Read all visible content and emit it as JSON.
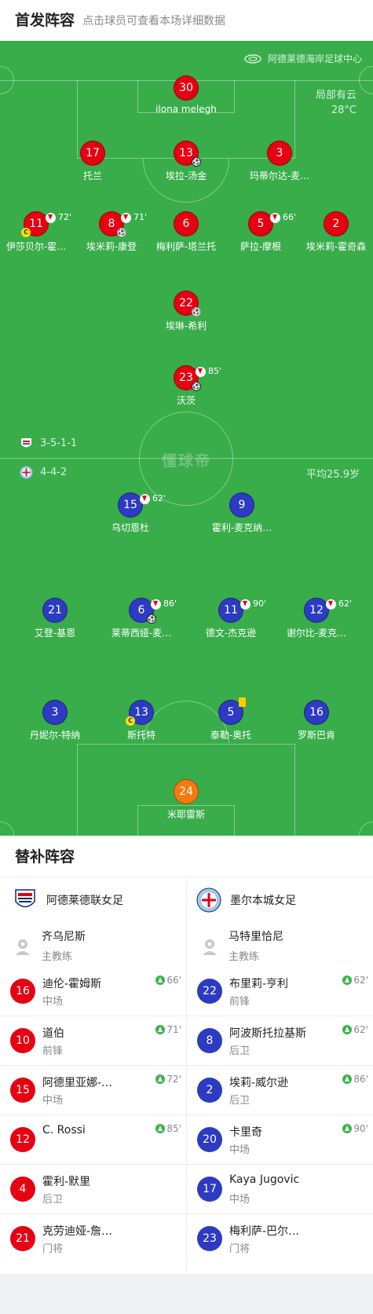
{
  "header": {
    "title": "首发阵容",
    "subtitle": "点击球员可查看本场详细数据"
  },
  "pitch": {
    "venue": "阿德莱德海岸足球中心",
    "weather": "局部有云",
    "temperature": "28°C",
    "watermark": "懂球帝",
    "home_formation": "3-5-1-1",
    "away_formation": "4-4-2",
    "away_avg_age": "平均25.9岁"
  },
  "home_players": [
    {
      "num": "30",
      "name": "ilona melegh"
    },
    {
      "num": "17",
      "name": "托兰"
    },
    {
      "num": "13",
      "name": "埃拉-汤金"
    },
    {
      "num": "3",
      "name": "玛蒂尔达-麦…"
    },
    {
      "num": "11",
      "name": "伊莎贝尔-霍…",
      "sub": "72'"
    },
    {
      "num": "8",
      "name": "埃米莉-康登",
      "sub": "71'"
    },
    {
      "num": "6",
      "name": "梅利萨-塔兰托"
    },
    {
      "num": "5",
      "name": "萨拉-摩根",
      "sub": "66'"
    },
    {
      "num": "2",
      "name": "埃米莉-霍奇森"
    },
    {
      "num": "22",
      "name": "埃琳-希利"
    },
    {
      "num": "23",
      "name": "沃茨",
      "sub": "85'"
    }
  ],
  "away_players": [
    {
      "num": "15",
      "name": "乌切恩杜",
      "sub": "62'"
    },
    {
      "num": "9",
      "name": "霍利-麦克纳…"
    },
    {
      "num": "21",
      "name": "艾登-基恩"
    },
    {
      "num": "6",
      "name": "莱蒂西娅-麦…",
      "sub": "86'"
    },
    {
      "num": "11",
      "name": "德文-杰克逊",
      "sub": "90'"
    },
    {
      "num": "12",
      "name": "谢尔比-麦克…",
      "sub": "62'"
    },
    {
      "num": "3",
      "name": "丹妮尔-特纳"
    },
    {
      "num": "13",
      "name": "斯托特"
    },
    {
      "num": "5",
      "name": "泰勒-奥托"
    },
    {
      "num": "16",
      "name": "罗斯巴肯"
    },
    {
      "num": "24",
      "name": "米耶雷斯"
    }
  ],
  "subs": {
    "title": "替补阵容",
    "home": {
      "team": "阿德莱德联女足",
      "coach": {
        "name": "齐乌尼斯",
        "role": "主教练"
      },
      "players": [
        {
          "num": "16",
          "name": "迪伦-霍姆斯",
          "pos": "中场",
          "in": "66'"
        },
        {
          "num": "10",
          "name": "道伯",
          "pos": "前锋",
          "in": "71'"
        },
        {
          "num": "15",
          "name": "阿德里亚娜-…",
          "pos": "中场",
          "in": "72'"
        },
        {
          "num": "12",
          "name": "C. Rossi",
          "pos": "",
          "in": "85'"
        },
        {
          "num": "4",
          "name": "霍利-默里",
          "pos": "后卫",
          "in": ""
        },
        {
          "num": "21",
          "name": "克劳迪娅-詹…",
          "pos": "门将",
          "in": ""
        }
      ]
    },
    "away": {
      "team": "墨尔本城女足",
      "coach": {
        "name": "马特里恰尼",
        "role": "主教练"
      },
      "players": [
        {
          "num": "22",
          "name": "布里莉-亨利",
          "pos": "前锋",
          "in": "62'"
        },
        {
          "num": "8",
          "name": "阿波斯托拉基斯",
          "pos": "后卫",
          "in": "62'"
        },
        {
          "num": "2",
          "name": "埃莉-威尔逊",
          "pos": "后卫",
          "in": "86'"
        },
        {
          "num": "20",
          "name": "卡里奇",
          "pos": "中场",
          "in": "90'"
        },
        {
          "num": "17",
          "name": "Kaya Jugovic",
          "pos": "中场",
          "in": ""
        },
        {
          "num": "23",
          "name": "梅利萨-巴尔…",
          "pos": "门将",
          "in": ""
        }
      ]
    }
  },
  "colors": {
    "pitch": "#38ad4a",
    "home": "#e60012",
    "away": "#2c3bc1",
    "keeper_away": "#f57a10",
    "sub_in": "#39b54a"
  }
}
